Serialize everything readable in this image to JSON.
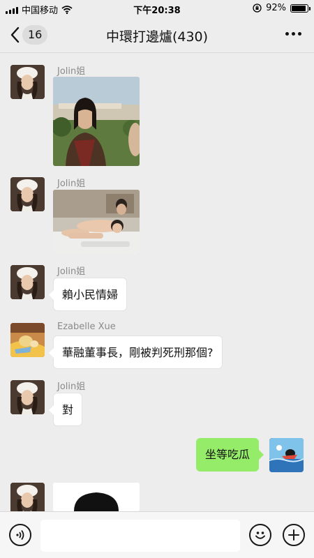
{
  "status": {
    "carrier": "中国移动",
    "time": "下午20:38",
    "battery": "92%",
    "battery_level": 0.92
  },
  "nav": {
    "back_count": "16",
    "title": "中環打邊爐(430)"
  },
  "messages": [
    {
      "sender": "Jolin姐",
      "type": "image",
      "image": "photo-woman-outdoors"
    },
    {
      "sender": "Jolin姐",
      "type": "image",
      "image": "photo-bed"
    },
    {
      "sender": "Jolin姐",
      "type": "text",
      "text": "賴小民情婦"
    },
    {
      "sender": "Ezabelle Xue",
      "type": "text",
      "text": "華融董事長，剛被判死刑那個?"
    },
    {
      "sender": "Jolin姐",
      "type": "text",
      "text": "對"
    },
    {
      "sender": "me",
      "type": "text",
      "text": "坐等吃瓜"
    },
    {
      "sender": "Jolin姐",
      "type": "image",
      "image": "photo-partial"
    }
  ],
  "input": {
    "placeholder": ""
  },
  "icons": {
    "voice": "voice-icon",
    "emoji": "emoji-icon",
    "plus": "plus-icon",
    "wifi": "wifi-icon",
    "lock": "rotation-lock-icon"
  },
  "colors": {
    "background": "#ededed",
    "outgoing_bubble": "#95ec69",
    "incoming_bubble": "#ffffff"
  }
}
